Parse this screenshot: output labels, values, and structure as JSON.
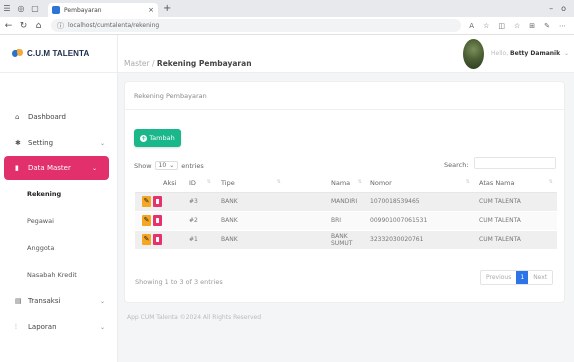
{
  "browser": {
    "tab_title": "Pembayaran",
    "url": "localhost/cumtalenta/rekening"
  },
  "app": {
    "brand": "C.U.M TALENTA",
    "user": {
      "greeting": "Hello",
      "name": "Betty Damanik"
    }
  },
  "sidebar": {
    "items": [
      {
        "label": "Dashboard"
      },
      {
        "label": "Setting"
      },
      {
        "label": "Data Master"
      },
      {
        "label": "Transaksi"
      },
      {
        "label": "Laporan"
      }
    ],
    "sub_items": [
      {
        "label": "Rekening"
      },
      {
        "label": "Pegawai"
      },
      {
        "label": "Anggota"
      },
      {
        "label": "Nasabah Kredit"
      }
    ]
  },
  "breadcrumb": {
    "parent": "Master",
    "sep": " / ",
    "current": "Rekening Pembayaran"
  },
  "card": {
    "title": "Rekening Pembayaran",
    "add_label": "Tambah",
    "show_label": "Show",
    "show_value": "10",
    "entries_label": "entries",
    "search_label": "Search:",
    "info": "Showing 1 to 3 of 3 entries"
  },
  "table": {
    "headers": [
      "Aksi",
      "ID",
      "Tipe",
      "Nama",
      "Nomor",
      "Atas Nama"
    ],
    "rows": [
      {
        "id": "#3",
        "tipe": "BANK",
        "nama": "MANDIRI",
        "nomor": "1070018539465",
        "atas_nama": "CUM TALENTA"
      },
      {
        "id": "#2",
        "tipe": "BANK",
        "nama": "BRI",
        "nomor": "009901007061531",
        "atas_nama": "CUM TALENTA"
      },
      {
        "id": "#1",
        "tipe": "BANK",
        "nama": "BANK SUMUT",
        "nomor": "32332030020761",
        "atas_nama": "CUM TALENTA"
      }
    ]
  },
  "pagination": {
    "previous": "Previous",
    "page": "1",
    "next": "Next"
  },
  "footer": "App CUM Talenta ©2024 All Rights Reserved",
  "colors": {
    "accent": "#e1306c",
    "success": "#1ab78a",
    "primary": "#2d74e8",
    "warning": "#f5a623"
  }
}
